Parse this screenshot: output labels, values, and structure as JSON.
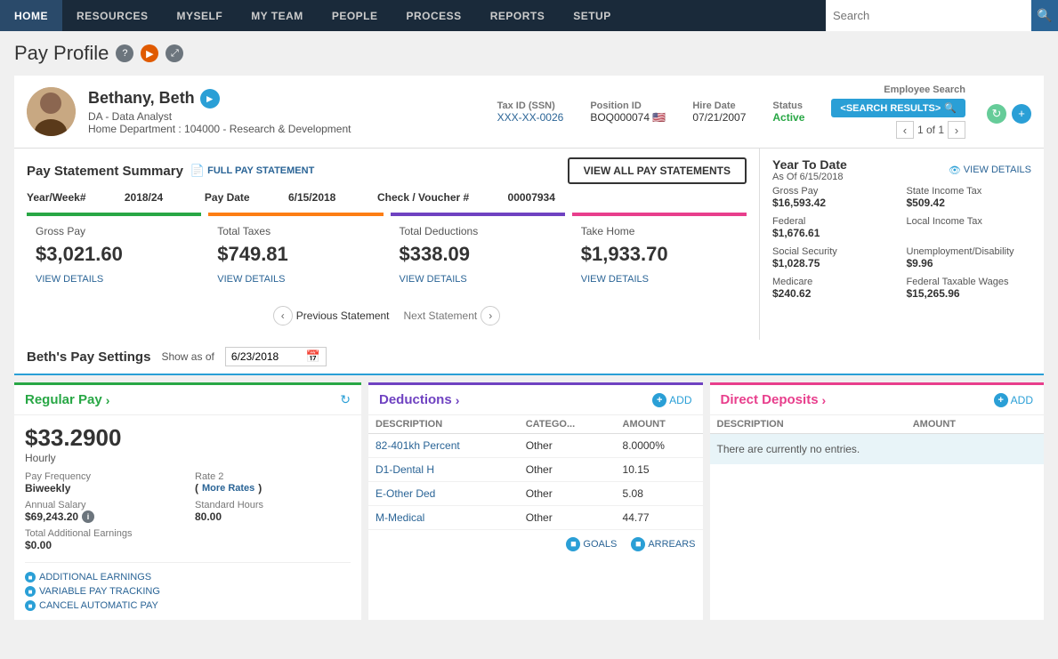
{
  "nav": {
    "items": [
      {
        "label": "HOME",
        "active": true
      },
      {
        "label": "RESOURCES",
        "active": false
      },
      {
        "label": "MYSELF",
        "active": false
      },
      {
        "label": "MY TEAM",
        "active": false
      },
      {
        "label": "PEOPLE",
        "active": false
      },
      {
        "label": "PROCESS",
        "active": false
      },
      {
        "label": "REPORTS",
        "active": false
      },
      {
        "label": "SETUP",
        "active": false
      }
    ],
    "search_placeholder": "Search"
  },
  "page": {
    "title": "Pay Profile"
  },
  "employee": {
    "name": "Bethany, Beth",
    "title": "DA - Data Analyst",
    "department": "Home Department : 104000 - Research & Development",
    "tax_id_label": "Tax ID (SSN)",
    "tax_id": "XXX-XX-0026",
    "position_id_label": "Position ID",
    "position_id": "BOQ000074",
    "hire_date_label": "Hire Date",
    "hire_date": "07/21/2007",
    "status_label": "Status",
    "status": "Active",
    "employee_search_label": "Employee Search",
    "search_results_btn": "<SEARCH RESULTS>",
    "nav_count": "1 of 1"
  },
  "pay_summary": {
    "title": "Pay Statement Summary",
    "full_pay_link": "FULL PAY STATEMENT",
    "view_all_btn": "VIEW ALL PAY STATEMENTS",
    "year_week_label": "Year/Week#",
    "year_week": "2018/24",
    "pay_date_label": "Pay Date",
    "pay_date": "6/15/2018",
    "check_label": "Check / Voucher #",
    "check_num": "00007934",
    "cards": [
      {
        "label": "Gross Pay",
        "value": "$3,021.60",
        "link": "VIEW DETAILS",
        "color": "green"
      },
      {
        "label": "Total Taxes",
        "value": "$749.81",
        "link": "VIEW DETAILS",
        "color": "orange"
      },
      {
        "label": "Total Deductions",
        "value": "$338.09",
        "link": "VIEW DETAILS",
        "color": "purple"
      },
      {
        "label": "Take Home",
        "value": "$1,933.70",
        "link": "VIEW DETAILS",
        "color": "magenta"
      }
    ],
    "prev_stmt": "Previous Statement",
    "next_stmt": "Next Statement",
    "ytd": {
      "title": "Year To Date",
      "as_of_label": "As Of",
      "as_of": "6/15/2018",
      "view_details": "VIEW DETAILS",
      "items": [
        {
          "label": "Gross Pay",
          "value": "$16,593.42"
        },
        {
          "label": "State Income Tax",
          "value": "$509.42"
        },
        {
          "label": "Federal",
          "value": "$1,676.61"
        },
        {
          "label": "Local Income Tax",
          "value": ""
        },
        {
          "label": "Social Security",
          "value": "$1,028.75"
        },
        {
          "label": "Unemployment/Disability",
          "value": "$9.96"
        },
        {
          "label": "Medicare",
          "value": "$240.62"
        },
        {
          "label": "Federal Taxable Wages",
          "value": "$15,265.96"
        }
      ]
    }
  },
  "pay_settings": {
    "title": "Beth's Pay Settings",
    "show_as_of": "Show as of",
    "date": "6/23/2018"
  },
  "regular_pay": {
    "title": "Regular Pay",
    "rate": "$33.2900",
    "rate_sub": "Hourly",
    "pay_frequency_label": "Pay Frequency",
    "pay_frequency": "Biweekly",
    "annual_salary_label": "Annual Salary",
    "annual_salary": "$69,243.20",
    "rate2_label": "Rate 2",
    "more_rates": "More Rates",
    "std_hours_label": "Standard Hours",
    "std_hours": "80.00",
    "total_add_earn_label": "Total Additional Earnings",
    "total_add_earn": "$0.00",
    "actions": [
      {
        "label": "ADDITIONAL EARNINGS"
      },
      {
        "label": "VARIABLE PAY TRACKING"
      },
      {
        "label": "CANCEL AUTOMATIC PAY"
      }
    ]
  },
  "deductions": {
    "title": "Deductions",
    "add_label": "ADD",
    "columns": [
      "DESCRIPTION",
      "CATEGO...",
      "AMOUNT"
    ],
    "rows": [
      {
        "description": "82-401kh Percent",
        "category": "Other",
        "amount": "8.0000%"
      },
      {
        "description": "D1-Dental H",
        "category": "Other",
        "amount": "10.15"
      },
      {
        "description": "E-Other Ded",
        "category": "Other",
        "amount": "5.08"
      },
      {
        "description": "M-Medical",
        "category": "Other",
        "amount": "44.77"
      }
    ],
    "footer_links": [
      "GOALS",
      "ARREARS"
    ]
  },
  "direct_deposits": {
    "title": "Direct Deposits",
    "add_label": "ADD",
    "columns": [
      "DESCRIPTION",
      "AMOUNT"
    ],
    "empty_message": "There are currently no entries."
  }
}
